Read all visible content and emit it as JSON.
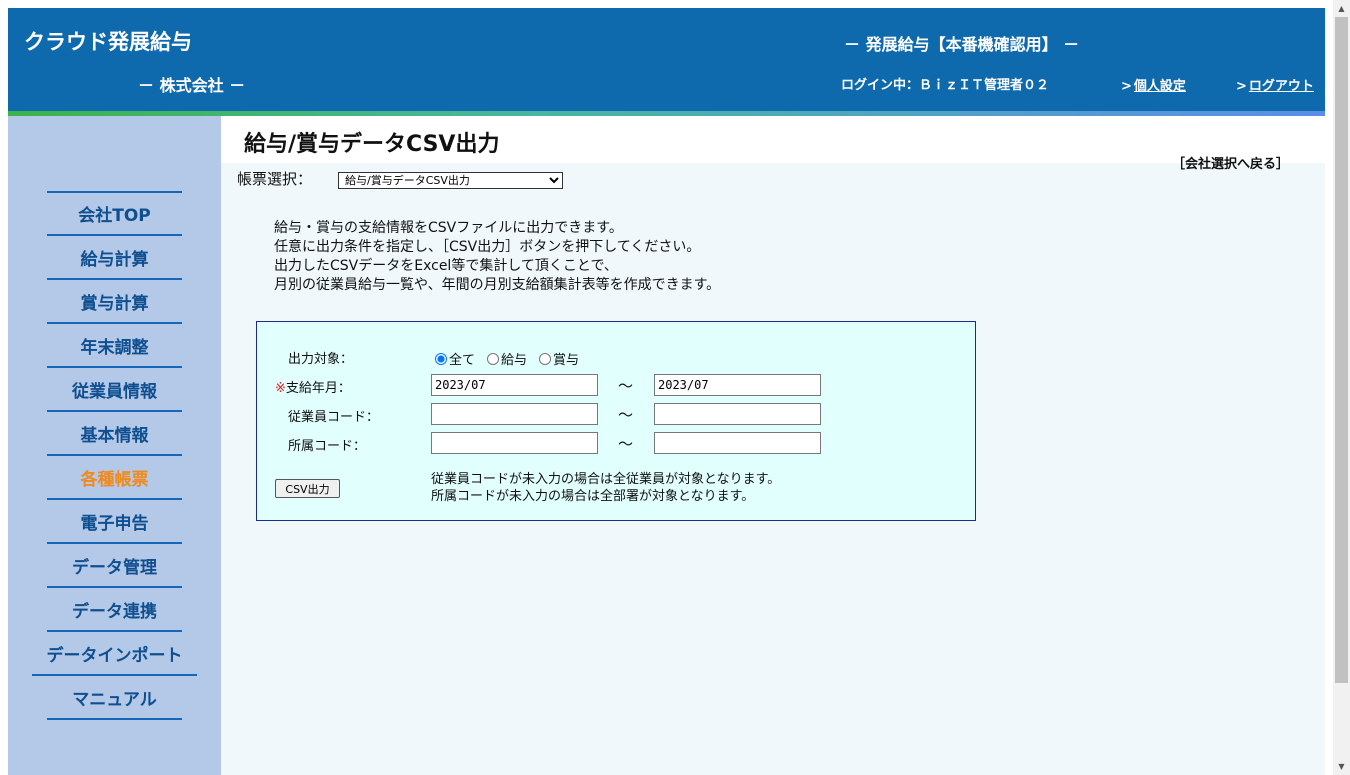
{
  "header": {
    "app_logo": "クラウド発展給与",
    "company_name": "－ 株式会社 －",
    "env_title": "－ 発展給与【本番機確認用】 －",
    "login_status": "ログイン中：ＢｉｚＩＴ管理者０２",
    "personal_settings": "個人設定",
    "logout": "ログアウト",
    "link_arrow": ">",
    "bg_color": "#0f6aad"
  },
  "sidebar": {
    "items": [
      {
        "label": "会社TOP"
      },
      {
        "label": "給与計算"
      },
      {
        "label": "賞与計算"
      },
      {
        "label": "年末調整"
      },
      {
        "label": "従業員情報"
      },
      {
        "label": "基本情報"
      },
      {
        "label": "各種帳票",
        "active": true
      },
      {
        "label": "電子申告"
      },
      {
        "label": "データ管理"
      },
      {
        "label": "データ連携"
      },
      {
        "label": "データインポート"
      },
      {
        "label": "マニュアル"
      }
    ],
    "active_color": "#f08a1c"
  },
  "main": {
    "title": "給与/賞与データCSV出力",
    "back_link": "［会社選択へ戻る］",
    "report_select_label": "帳票選択：",
    "report_select_value": "給与/賞与データCSV出力",
    "description": [
      "給与・賞与の支給情報をCSVファイルに出力できます。",
      "任意に出力条件を指定し、［CSV出力］ボタンを押下してください。",
      "出力したCSVデータをExcel等で集計して頂くことで、",
      "月別の従業員給与一覧や、年間の月別支給額集計表等を作成できます。"
    ]
  },
  "form": {
    "output_target_label": "出力対象：",
    "radio_all": "全て",
    "radio_salary": "給与",
    "radio_bonus": "賞与",
    "selected_radio": "全て",
    "required_mark": "※",
    "pay_month_label": "支給年月：",
    "pay_month_from": "2023/07",
    "pay_month_to": "2023/07",
    "employee_code_label": "従業員コード：",
    "employee_code_from": "",
    "employee_code_to": "",
    "dept_code_label": "所属コード：",
    "dept_code_from": "",
    "dept_code_to": "",
    "range_separator": "～",
    "csv_button": "CSV出力",
    "note_1": "従業員コードが未入力の場合は全従業員が対象となります。",
    "note_2": "所属コードが未入力の場合は全部署が対象となります。"
  }
}
